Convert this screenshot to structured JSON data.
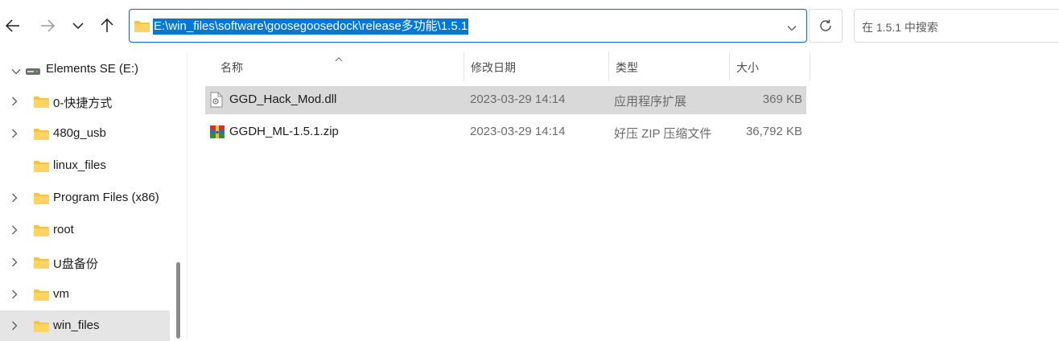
{
  "toolbar": {
    "back_icon": "arrow-left-icon",
    "forward_icon": "arrow-right-icon",
    "recent_icon": "chevron-down-icon",
    "up_icon": "arrow-up-icon",
    "refresh_icon": "refresh-icon"
  },
  "address": {
    "path": "E:\\win_files\\software\\goosegoosedock\\release多功能\\1.5.1",
    "selection_color": "#0078d7"
  },
  "search": {
    "placeholder": "在 1.5.1 中搜索"
  },
  "nav": {
    "drive": "Elements SE (E:)",
    "folders": [
      {
        "label": "0-快捷方式",
        "expandable": true
      },
      {
        "label": "480g_usb",
        "expandable": true
      },
      {
        "label": "linux_files",
        "expandable": false
      },
      {
        "label": "Program Files (x86)",
        "expandable": true
      },
      {
        "label": "root",
        "expandable": true
      },
      {
        "label": "U盘备份",
        "expandable": true
      },
      {
        "label": "vm",
        "expandable": true
      },
      {
        "label": "win_files",
        "expandable": true,
        "selected": true
      }
    ]
  },
  "list": {
    "columns": {
      "name": "名称",
      "date": "修改日期",
      "type": "类型",
      "size": "大小"
    },
    "rows": [
      {
        "name": "GGD_Hack_Mod.dll",
        "date": "2023-03-29 14:14",
        "type": "应用程序扩展",
        "size": "369 KB",
        "icon": "dll-file-icon",
        "selected": true
      },
      {
        "name": "GGDH_ML-1.5.1.zip",
        "date": "2023-03-29 14:14",
        "type": "好压 ZIP 压缩文件",
        "size": "36,792 KB",
        "icon": "zip-archive-icon",
        "selected": false
      }
    ]
  },
  "colors": {
    "accent": "#0067c0",
    "folder": "#f8c53a",
    "selected_row": "#d9d9d9"
  }
}
